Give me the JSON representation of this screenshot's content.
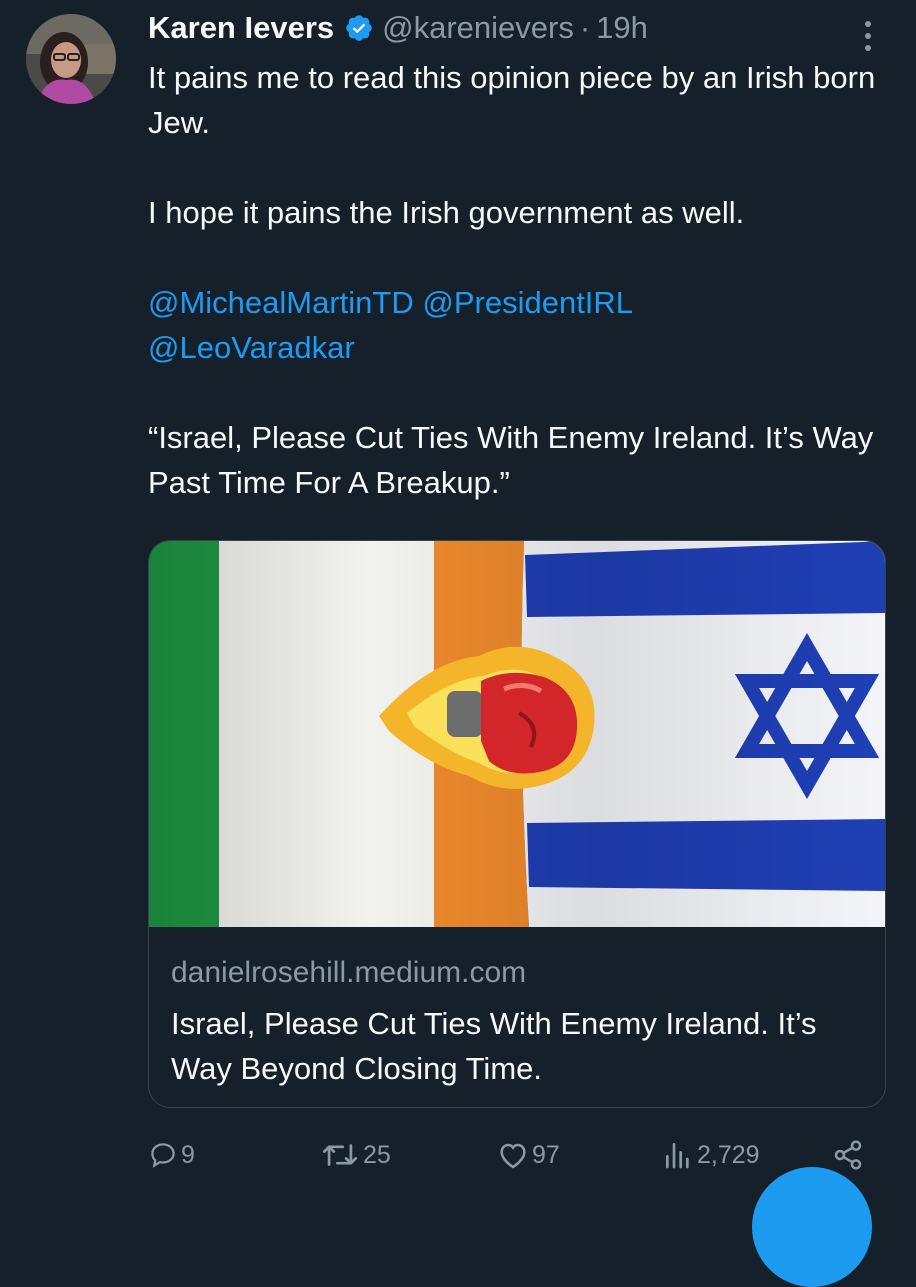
{
  "author": {
    "name": "Karen Ievers",
    "handle": "@karenievers",
    "separator": "·",
    "time": "19h",
    "verified": true
  },
  "tweet": {
    "paragraphs": [
      "It pains me to read this opinion piece by an Irish born Jew.",
      "I hope it pains the Irish government as well."
    ],
    "mentions": [
      "@MichealMartinTD",
      "@PresidentIRL",
      "@LeoVaradkar"
    ],
    "quote": "“Israel, Please Cut Ties With Enemy Ireland. It’s Way Past Time For A Breakup.”"
  },
  "card": {
    "domain": "danielrosehill.medium.com",
    "title": "Israel, Please Cut Ties With Enemy Ireland. It’s Way Beyond Closing Time."
  },
  "actions": {
    "replies": "9",
    "reposts": "25",
    "likes": "97",
    "views": "2,729"
  },
  "colors": {
    "background": "#15202b",
    "accent": "#1d9bf0",
    "muted": "#8b98a5"
  },
  "icons": [
    "verified-badge-icon",
    "more-icon",
    "reply-icon",
    "repost-icon",
    "like-icon",
    "views-icon",
    "share-icon"
  ]
}
